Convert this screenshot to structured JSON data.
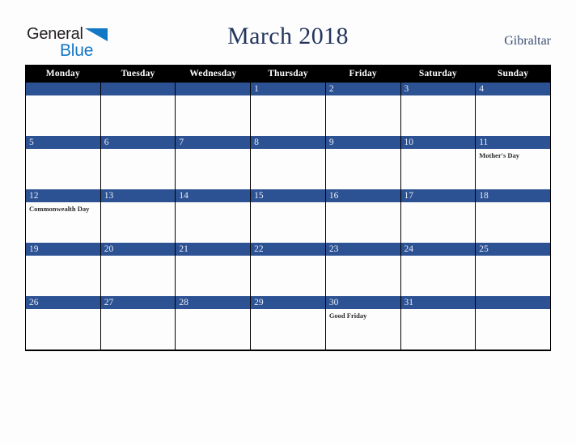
{
  "logo": {
    "word1": "General",
    "word2": "Blue",
    "triangle_color": "#1277c4",
    "word1_color": "#231f20",
    "word2_color": "#1277c4"
  },
  "header": {
    "month_title": "March 2018",
    "country": "Gibraltar",
    "title_color": "#24365e",
    "country_color": "#3c4f73"
  },
  "calendar": {
    "accent_color": "#2d5293",
    "header_bg": "#000000",
    "header_text_color": "#ffffff",
    "weekday_headers": [
      "Monday",
      "Tuesday",
      "Wednesday",
      "Thursday",
      "Friday",
      "Saturday",
      "Sunday"
    ],
    "weeks": [
      [
        {
          "day": "",
          "events": []
        },
        {
          "day": "",
          "events": []
        },
        {
          "day": "",
          "events": []
        },
        {
          "day": "1",
          "events": []
        },
        {
          "day": "2",
          "events": []
        },
        {
          "day": "3",
          "events": []
        },
        {
          "day": "4",
          "events": []
        }
      ],
      [
        {
          "day": "5",
          "events": []
        },
        {
          "day": "6",
          "events": []
        },
        {
          "day": "7",
          "events": []
        },
        {
          "day": "8",
          "events": []
        },
        {
          "day": "9",
          "events": []
        },
        {
          "day": "10",
          "events": []
        },
        {
          "day": "11",
          "events": [
            "Mother's Day"
          ]
        }
      ],
      [
        {
          "day": "12",
          "events": [
            "Commonwealth Day"
          ]
        },
        {
          "day": "13",
          "events": []
        },
        {
          "day": "14",
          "events": []
        },
        {
          "day": "15",
          "events": []
        },
        {
          "day": "16",
          "events": []
        },
        {
          "day": "17",
          "events": []
        },
        {
          "day": "18",
          "events": []
        }
      ],
      [
        {
          "day": "19",
          "events": []
        },
        {
          "day": "20",
          "events": []
        },
        {
          "day": "21",
          "events": []
        },
        {
          "day": "22",
          "events": []
        },
        {
          "day": "23",
          "events": []
        },
        {
          "day": "24",
          "events": []
        },
        {
          "day": "25",
          "events": []
        }
      ],
      [
        {
          "day": "26",
          "events": []
        },
        {
          "day": "27",
          "events": []
        },
        {
          "day": "28",
          "events": []
        },
        {
          "day": "29",
          "events": []
        },
        {
          "day": "30",
          "events": [
            "Good Friday"
          ]
        },
        {
          "day": "31",
          "events": []
        },
        {
          "day": "",
          "events": []
        }
      ]
    ]
  }
}
